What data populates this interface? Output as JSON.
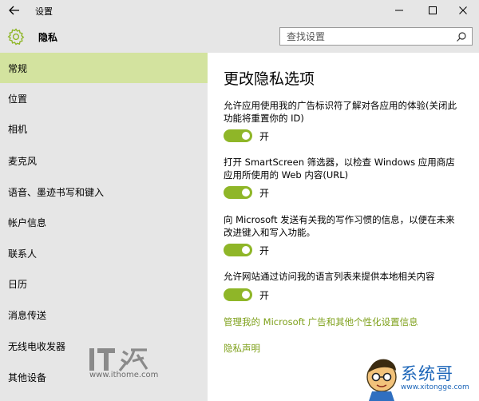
{
  "window": {
    "title": "设置",
    "back_icon": "arrow-left-icon",
    "minimize_icon": "minimize-icon",
    "maximize_icon": "maximize-icon",
    "close_icon": "close-icon"
  },
  "header": {
    "icon": "gear-icon",
    "section": "隐私",
    "search_placeholder": "查找设置",
    "search_icon": "search-icon"
  },
  "sidebar": {
    "items": [
      {
        "label": "常规",
        "active": true
      },
      {
        "label": "位置",
        "active": false
      },
      {
        "label": "相机",
        "active": false
      },
      {
        "label": "麦克风",
        "active": false
      },
      {
        "label": "语音、墨迹书写和键入",
        "active": false
      },
      {
        "label": "帐户信息",
        "active": false
      },
      {
        "label": "联系人",
        "active": false
      },
      {
        "label": "日历",
        "active": false
      },
      {
        "label": "消息传送",
        "active": false
      },
      {
        "label": "无线电收发器",
        "active": false
      },
      {
        "label": "其他设备",
        "active": false
      }
    ]
  },
  "main": {
    "title": "更改隐私选项",
    "options": [
      {
        "text": "允许应用使用我的广告标识符了解对各应用的体验(关闭此功能将重置你的 ID)",
        "state_label": "开",
        "on": true
      },
      {
        "text": "打开 SmartScreen 筛选器，以检查 Windows 应用商店应用所使用的 Web 内容(URL)",
        "state_label": "开",
        "on": true
      },
      {
        "text": "向 Microsoft 发送有关我的写作习惯的信息，以便在未来改进键入和写入功能。",
        "state_label": "开",
        "on": true
      },
      {
        "text": "允许网站通过访问我的语言列表来提供本地相关内容",
        "state_label": "开",
        "on": true
      }
    ],
    "links": [
      {
        "label": "管理我的 Microsoft 广告和其他个性化设置信息"
      },
      {
        "label": "隐私声明"
      }
    ]
  },
  "watermarks": {
    "left_logo_text": "IT之家",
    "left_url": "www.ithome.com",
    "right_name": "系统哥",
    "right_url": "www.xitongge.com"
  },
  "colors": {
    "chrome_bg": "#e6e6e6",
    "active_nav": "#d3e39f",
    "accent": "#8fb628",
    "link": "#7ea01a"
  }
}
